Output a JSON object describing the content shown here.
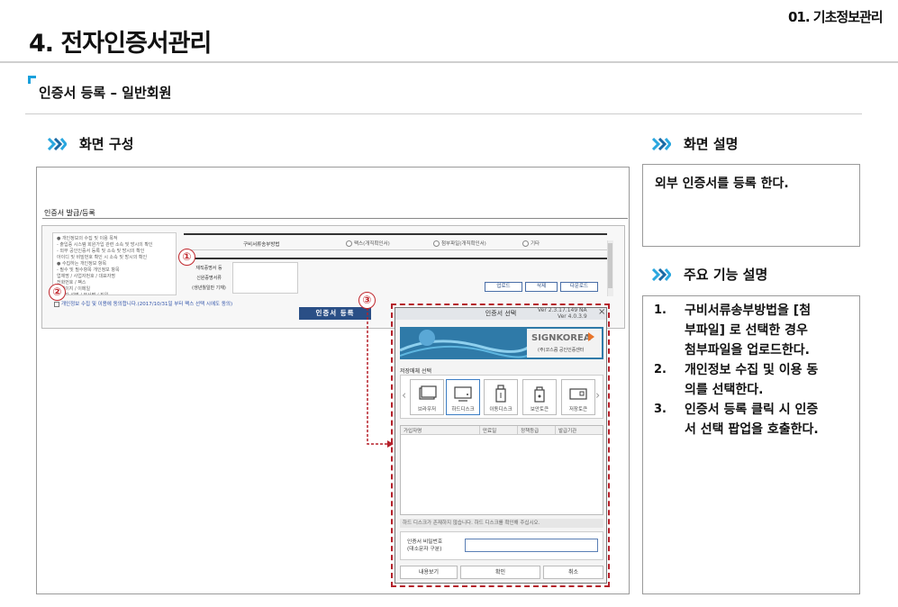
{
  "header": {
    "chapter": "01. 기초정보관리",
    "page_title": "4. 전자인증서관리",
    "section_title": "인증서 등록 – 일반회원"
  },
  "left_panel": {
    "heading": "화면 구성"
  },
  "mock": {
    "section_label": "인증서 발급/등록",
    "consent_lines": [
      "● 개인정보의 수집 및 이용 목적",
      "  - 출입증 시스템 회원가입 관련 소속 및 방시의 확인",
      "  - 외부 공인인증서 등록 및 소속 및 방시의 확인",
      "  아이디 및 비밀번호 확인 시 소속 및 방시의 확인",
      "● 수집하는 개인정보 항목",
      "  - 필수 및 필수항목 개인정보 항목",
      "  업체명 / 사업자번호 / 대표자명",
      "  전화번호 / 팩스",
      "  홈페이지 / 이메일",
      "  담당자 성명 / 부서명 / 직위",
      "  담당자 연락처 (휴대폰번호) / 생년월일 / 소속"
    ],
    "consent_check": "개인정보 수집 및 이용에 동의합니다.(2017/10/31일 부터 팩스 선택 시에도 동의)",
    "method_label": "구비서류송부방법",
    "radio_options": [
      "팩스(개직확인서)",
      "첨부파일(개직확인서)",
      "기타"
    ],
    "upload_label": [
      "재직증명서 등",
      "신원증명서류",
      "(생년월일만 기재)"
    ],
    "buttons": [
      "업로드",
      "삭제",
      "다운로드"
    ],
    "register_button": "인증서 등록"
  },
  "popup": {
    "title": "인증서 선택",
    "version": [
      "Ver 2.3.17.149 NA",
      "Ver 4.0.3.9"
    ],
    "close": "×",
    "brand": "SIGNKOREA",
    "brand_sub": "(주)코스콤 공인인증센터",
    "media_label": "저장매체 선택",
    "media": [
      {
        "label": "브라우저",
        "icon": "browser-icon"
      },
      {
        "label": "하드디스크",
        "icon": "hard-disk-icon"
      },
      {
        "label": "이동디스크",
        "icon": "usb-icon"
      },
      {
        "label": "보안토큰",
        "icon": "security-token-icon"
      },
      {
        "label": "저장토큰",
        "icon": "storage-token-icon"
      }
    ],
    "table_headers": [
      "가입자명",
      "만료일",
      "정책등급",
      "발급기관"
    ],
    "status": "하드 디스크가 존재하지 않습니다. 하드 디스크를 확인해 주십시오.",
    "pw_label": [
      "인증서 비밀번호",
      "(대소문자 구분)"
    ],
    "buttons": [
      "내용보기",
      "확인",
      "취소"
    ]
  },
  "badges": [
    "①",
    "②",
    "③"
  ],
  "right_panel": {
    "desc_heading": "화면 설명",
    "desc_text": "외부 인증서를 등록 한다.",
    "func_heading": "주요 기능 설명",
    "functions": [
      {
        "num": "1.",
        "lines": [
          "구비서류송부방법을 [첨",
          "부파일] 로 선택한 경우",
          "첨부파일을 업로드한다."
        ]
      },
      {
        "num": "2.",
        "lines": [
          "개인정보 수집 및 이용 동",
          "의를 선택한다."
        ]
      },
      {
        "num": "3.",
        "lines": [
          "인증서 등록 클릭 시 인증",
          "서 선택 팝업을 호출한다."
        ]
      }
    ]
  },
  "colors": {
    "accent_blue": "#1aa0dc",
    "badge_red": "#c0272d",
    "button_navy": "#2a4f86"
  }
}
